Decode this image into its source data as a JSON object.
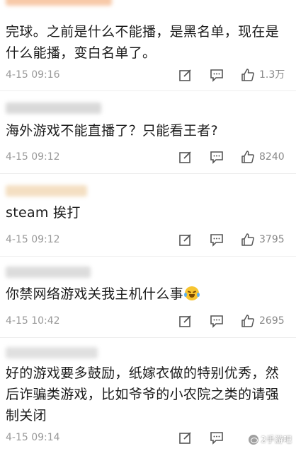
{
  "comments": [
    {
      "text": "完球。之前是什么不能播，是黑名单，现在是什么能播，变白名单了。",
      "time": "4-15 09:16",
      "likes": "1.3万",
      "name_color": "#f7c9a8"
    },
    {
      "text": "海外游戏不能直播了？只能看王者?",
      "time": "4-15 09:12",
      "likes": "8240",
      "name_color": "#d9d9d9"
    },
    {
      "text": "steam 挨打",
      "time": "4-15 09:12",
      "likes": "3795",
      "name_color": "#f4dfc2"
    },
    {
      "text": "你禁网络游戏关我主机什么事",
      "time": "4-15 10:42",
      "likes": "2695",
      "name_color": "#dcdcdc"
    },
    {
      "text": "好的游戏要多鼓励，纸嫁衣做的特别优秀，然后诈骗类游戏，比如爷爷的小农院之类的请强制关闭",
      "time": "4-15 09:14",
      "likes": "",
      "name_color": "#e0e0e0"
    }
  ],
  "icons": {
    "edit": "edit-icon",
    "reply": "reply-icon",
    "like": "thumbs-up-icon",
    "emoji": "crying-laughing-emoji"
  },
  "watermark": {
    "text": "2手游吧"
  }
}
